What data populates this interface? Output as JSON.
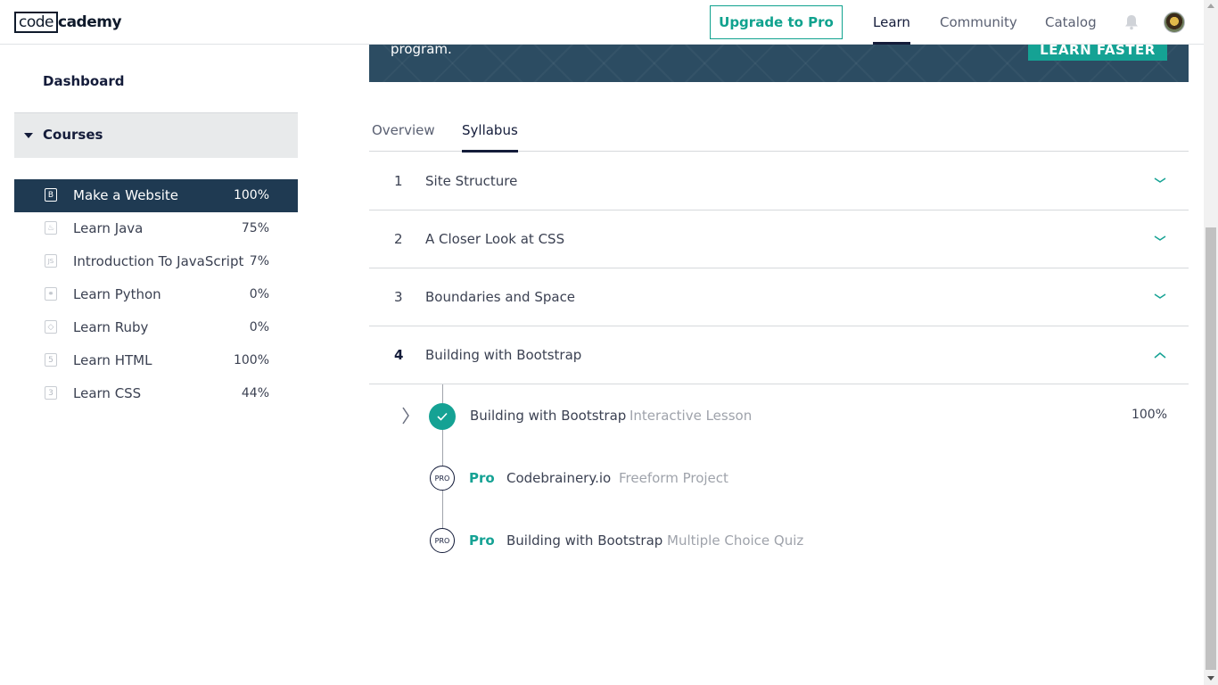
{
  "header": {
    "logo_box": "code",
    "logo_rest": "cademy",
    "upgrade_label": "Upgrade to Pro",
    "nav": {
      "learn": "Learn",
      "community": "Community",
      "catalog": "Catalog"
    }
  },
  "banner": {
    "text": "program.",
    "button_label": "LEARN FASTER"
  },
  "sidebar": {
    "dashboard": "Dashboard",
    "courses_label": "Courses",
    "courses": [
      {
        "name": "Make a Website",
        "percent": "100%",
        "icon": "bootstrap-icon",
        "glyph": "B"
      },
      {
        "name": "Learn Java",
        "percent": "75%",
        "icon": "java-icon",
        "glyph": "♨"
      },
      {
        "name": "Introduction To JavaScript",
        "percent": "7%",
        "icon": "javascript-icon",
        "glyph": "JS"
      },
      {
        "name": "Learn Python",
        "percent": "0%",
        "icon": "python-icon",
        "glyph": "⚭"
      },
      {
        "name": "Learn Ruby",
        "percent": "0%",
        "icon": "ruby-icon",
        "glyph": "◇"
      },
      {
        "name": "Learn HTML",
        "percent": "100%",
        "icon": "html-icon",
        "glyph": "5"
      },
      {
        "name": "Learn CSS",
        "percent": "44%",
        "icon": "css-icon",
        "glyph": "3"
      }
    ]
  },
  "tabs": {
    "overview": "Overview",
    "syllabus": "Syllabus"
  },
  "modules": [
    {
      "num": "1",
      "title": "Site Structure"
    },
    {
      "num": "2",
      "title": "A Closer Look at CSS"
    },
    {
      "num": "3",
      "title": "Boundaries and Space"
    },
    {
      "num": "4",
      "title": "Building with Bootstrap"
    }
  ],
  "lessons": [
    {
      "title": "Building with Bootstrap",
      "type": "Interactive Lesson",
      "percent": "100%"
    },
    {
      "badge": "PRO",
      "pro_label": "Pro",
      "title": "Codebrainery.io",
      "type": "Freeform Project"
    },
    {
      "badge": "PRO",
      "pro_label": "Pro",
      "title": "Building with Bootstrap",
      "type": "Multiple Choice Quiz"
    }
  ],
  "colors": {
    "accent": "#15a294",
    "navy": "#1f3a52",
    "banner": "#2c4c62"
  }
}
